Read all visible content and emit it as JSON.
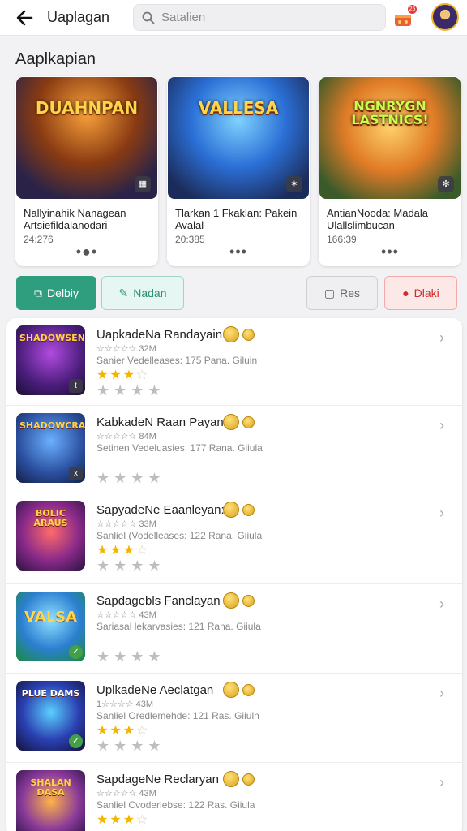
{
  "header": {
    "title": "Uaplagan",
    "search_placeholder": "Satalien",
    "cart_badge": "25"
  },
  "section_title": "Aaplkapian",
  "featured": [
    {
      "art_text": "DUAHNPAN",
      "art_icon": "grid-icon",
      "title": "Nallyinahik Nanagean Artsiefildalanodari",
      "meta": "24:276"
    },
    {
      "art_text": "VALLESA",
      "art_icon": "shuffle-icon",
      "title": "Tlarkan 1 Fkaklan: Pakein Avalal",
      "meta": "20:385"
    },
    {
      "art_text": "NGNRYGN LASTNICS!",
      "art_icon": "snowflake-icon",
      "title": "AntianNooda: Madala Ulallslimbucan",
      "meta": "166:39"
    }
  ],
  "actions": {
    "delbiy": "Delbiy",
    "nadan": "Nadan",
    "res": "Res",
    "dlaki": "Dlaki"
  },
  "list": [
    {
      "title": "UapkadeNa Randayain",
      "sub": "☆☆☆☆☆ 32M",
      "desc": "Sanier Vedelleases: 175 Pana. Giluin",
      "thumb_text": "SHADOWSEN",
      "rating": "★★★",
      "rating_empty": "☆",
      "badge": "t"
    },
    {
      "title": "KabkadeN Raan Payan",
      "sub": "☆☆☆☆☆ 84M",
      "desc": "Setinen Vedeluasies: 177 Rana. Giiula",
      "thumb_text": "SHADOWCRAN",
      "rating": "",
      "rating_empty": "",
      "badge": "x"
    },
    {
      "title": "SapyadeNe Eaanleyan:",
      "sub": "☆☆☆☆☆ 33M",
      "desc": "Sanliel (Vodelleases: 122 Rana. Giiula",
      "thumb_text": "BOLIC ARAUS",
      "rating": "★★★",
      "rating_empty": "☆",
      "badge": ""
    },
    {
      "title": "Sapdagebls Fanclayan",
      "sub": "☆☆☆☆☆ 43M",
      "desc": "Sariasal lekarvasies: 121 Rana. Giiula",
      "thumb_text": "VALSA",
      "rating": "",
      "rating_empty": "",
      "badge": "✓"
    },
    {
      "title": "UplkadeNe Aeclatgan",
      "sub": "1☆☆☆☆ 43M",
      "desc": "Sanliel Oredlemehde: 121 Ras. Giiuln",
      "thumb_text": "PLUE DAMS",
      "rating": "★★★",
      "rating_empty": "☆",
      "badge": "✓"
    },
    {
      "title": "SapdageNe Reclaryan",
      "sub": "☆☆☆☆☆ 43M",
      "desc": "Sanliel Cvoderlebse: 122 Ras. Giiula",
      "thumb_text": "SHALAN DASA",
      "rating": "★★★",
      "rating_empty": "☆",
      "badge": ""
    }
  ],
  "colors": {
    "accent_green": "#2e9e7e",
    "accent_red": "#d12b2b",
    "star_gold": "#f2b600"
  }
}
